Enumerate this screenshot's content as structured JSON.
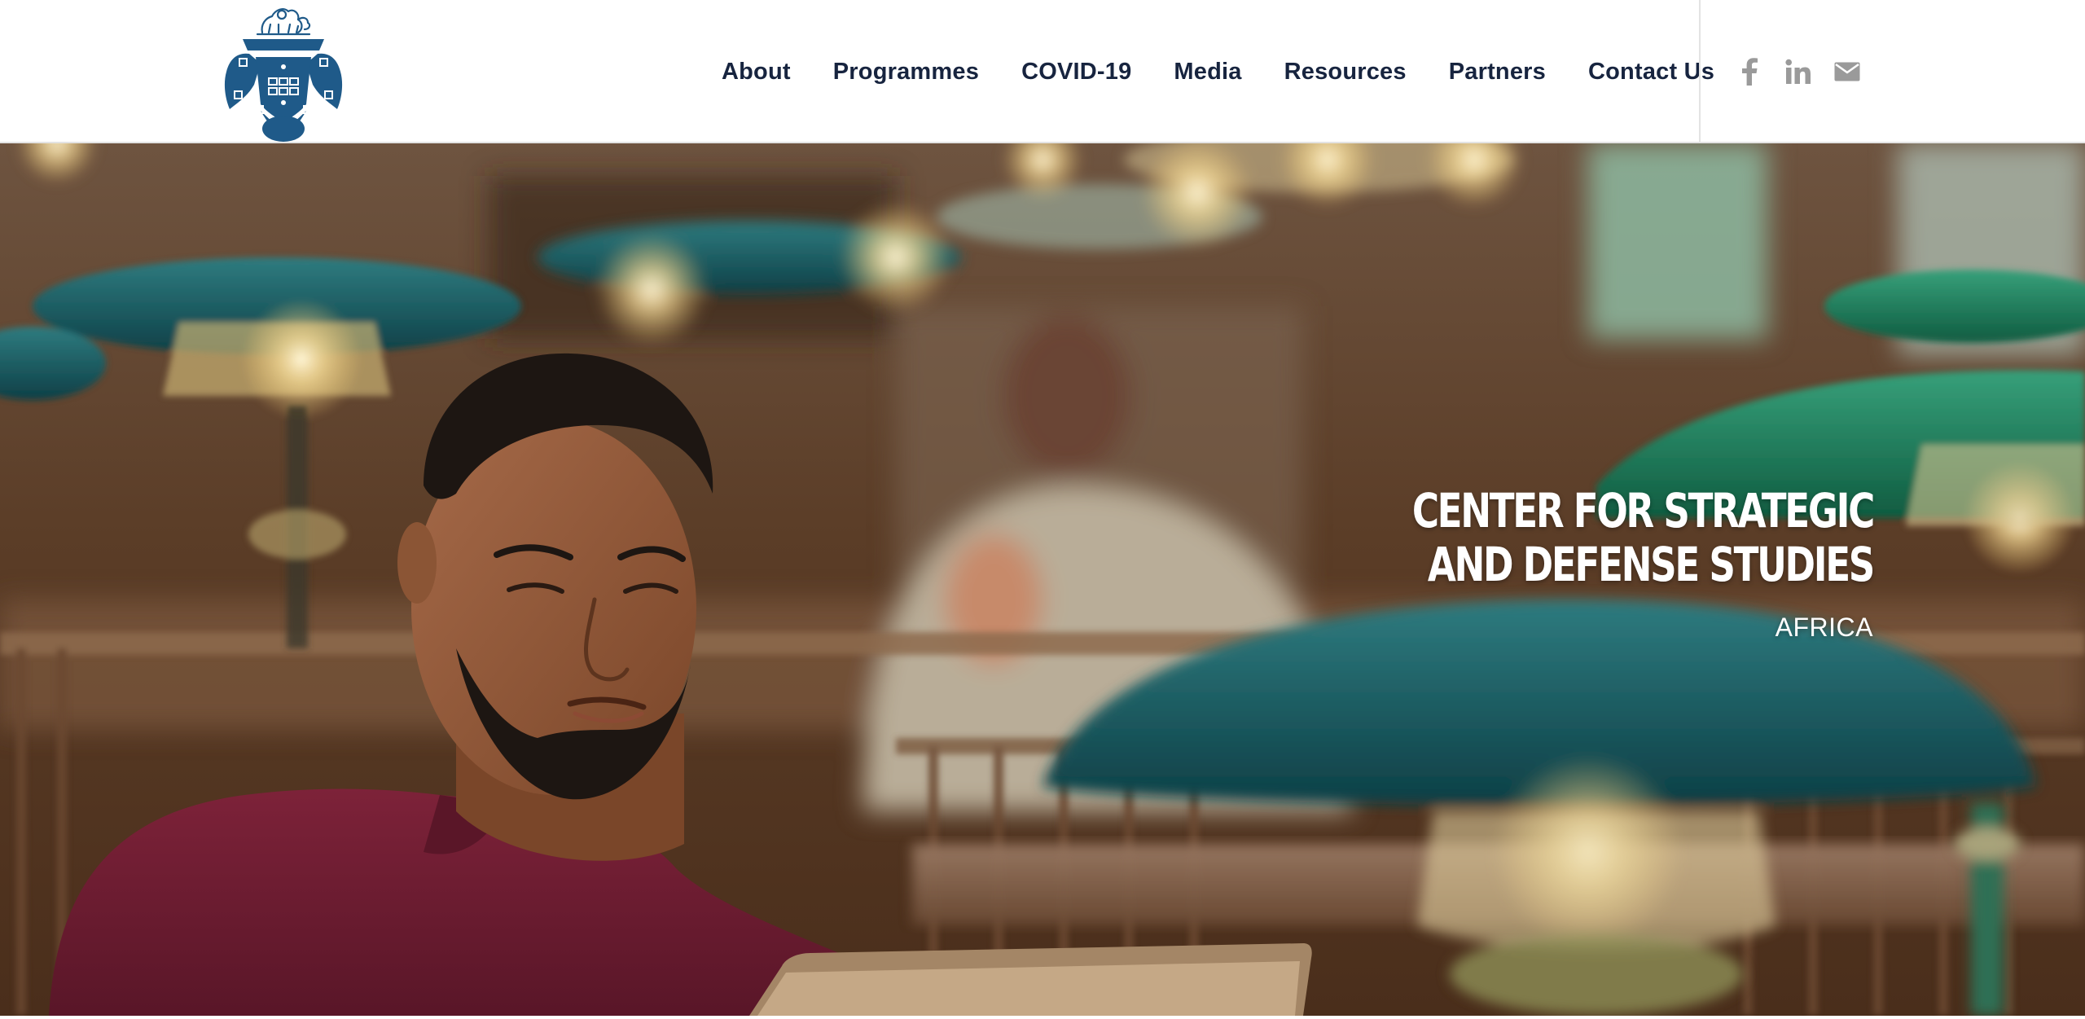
{
  "nav": {
    "items": [
      {
        "label": "About"
      },
      {
        "label": "Programmes"
      },
      {
        "label": "COVID-19"
      },
      {
        "label": "Media"
      },
      {
        "label": "Resources"
      },
      {
        "label": "Partners"
      },
      {
        "label": "Contact Us"
      }
    ]
  },
  "social": {
    "icons": [
      "facebook-icon",
      "linkedin-icon",
      "mail-icon"
    ],
    "icon_color": "#9a9a9a"
  },
  "hero": {
    "title": "CENTER FOR STRATEGIC AND DEFENSE STUDIES",
    "subtitle": "AFRICA"
  },
  "colors": {
    "brand_blue": "#1f5a89",
    "nav_text": "#17243f"
  }
}
